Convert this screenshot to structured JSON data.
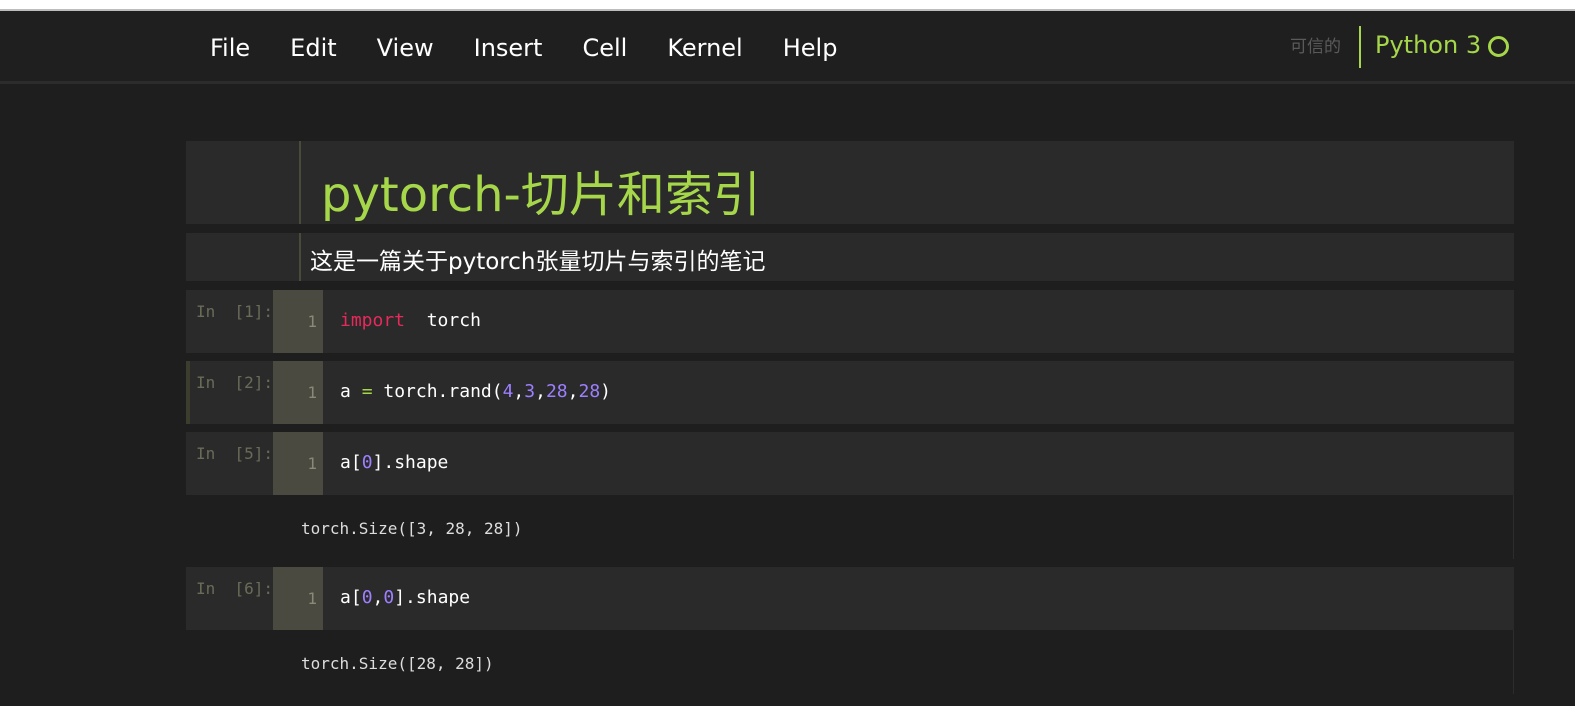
{
  "menubar": {
    "items": [
      {
        "label": "File"
      },
      {
        "label": "Edit"
      },
      {
        "label": "View"
      },
      {
        "label": "Insert"
      },
      {
        "label": "Cell"
      },
      {
        "label": "Kernel"
      },
      {
        "label": "Help"
      }
    ],
    "trusted_label": "可信的",
    "kernel_name": "Python 3"
  },
  "notebook": {
    "title": "pytorch-切片和索引",
    "description": "这是一篇关于pytorch张量切片与索引的笔记",
    "cells": [
      {
        "prompt": "In  [1]:",
        "line_number": "1",
        "tokens": {
          "kw": "import",
          "sp": "  ",
          "name": "torch"
        }
      },
      {
        "prompt": "In  [2]:",
        "line_number": "1",
        "tokens": {
          "t1": "a ",
          "op": "=",
          "t2": " torch.rand(",
          "n1": "4",
          "c1": ",",
          "n2": "3",
          "c2": ",",
          "n3": "28",
          "c3": ",",
          "n4": "28",
          "t3": ")"
        }
      },
      {
        "prompt": "In  [5]:",
        "line_number": "1",
        "tokens": {
          "t1": "a[",
          "n1": "0",
          "t2": "].shape"
        },
        "output": "torch.Size([3, 28, 28])"
      },
      {
        "prompt": "In  [6]:",
        "line_number": "1",
        "tokens": {
          "t1": "a[",
          "n1": "0",
          "c1": ",",
          "n2": "0",
          "t2": "].shape"
        },
        "output": "torch.Size([28, 28])"
      }
    ]
  },
  "colors": {
    "accent": "#a6d74a",
    "keyword": "#e7295b",
    "number": "#9d7fff",
    "background": "#1e1e1e"
  }
}
